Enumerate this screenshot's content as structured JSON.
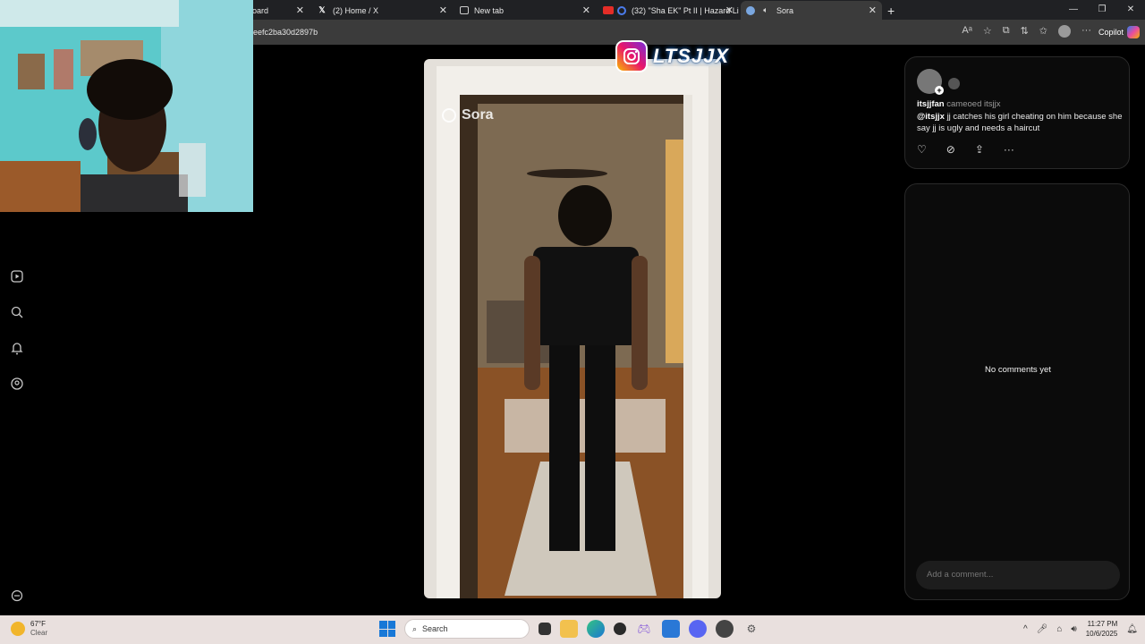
{
  "tabs": [
    {
      "label": "oard",
      "active": false
    },
    {
      "label": "(2) Home / X",
      "active": false
    },
    {
      "label": "New tab",
      "active": false
    },
    {
      "label": "(32) \"Sha EK\" Pt II | Hazard Li",
      "active": false
    },
    {
      "label": "Sora",
      "active": true
    }
  ],
  "address": {
    "url": "eefc2ba30d2897b"
  },
  "copilot": {
    "label": "Copilot"
  },
  "video": {
    "watermark": "Sora"
  },
  "instagram_overlay": {
    "handle": "LTSJJX"
  },
  "post": {
    "username": "itsjjfan",
    "cameo_text": "cameoed itsjjx",
    "mention": "@itsjjx",
    "caption": "jj catches his girl cheating on him because she say jj is ugly and needs a haircut"
  },
  "comments": {
    "empty_text": "No comments yet",
    "input_placeholder": "Add a comment..."
  },
  "taskbar": {
    "weather_temp": "67°F",
    "weather_desc": "Clear",
    "search_label": "Search",
    "time": "11:27 PM",
    "date": "10/6/2025"
  },
  "colors": {
    "accent_blue": "#1878d7",
    "moon": "#f1b52b"
  }
}
